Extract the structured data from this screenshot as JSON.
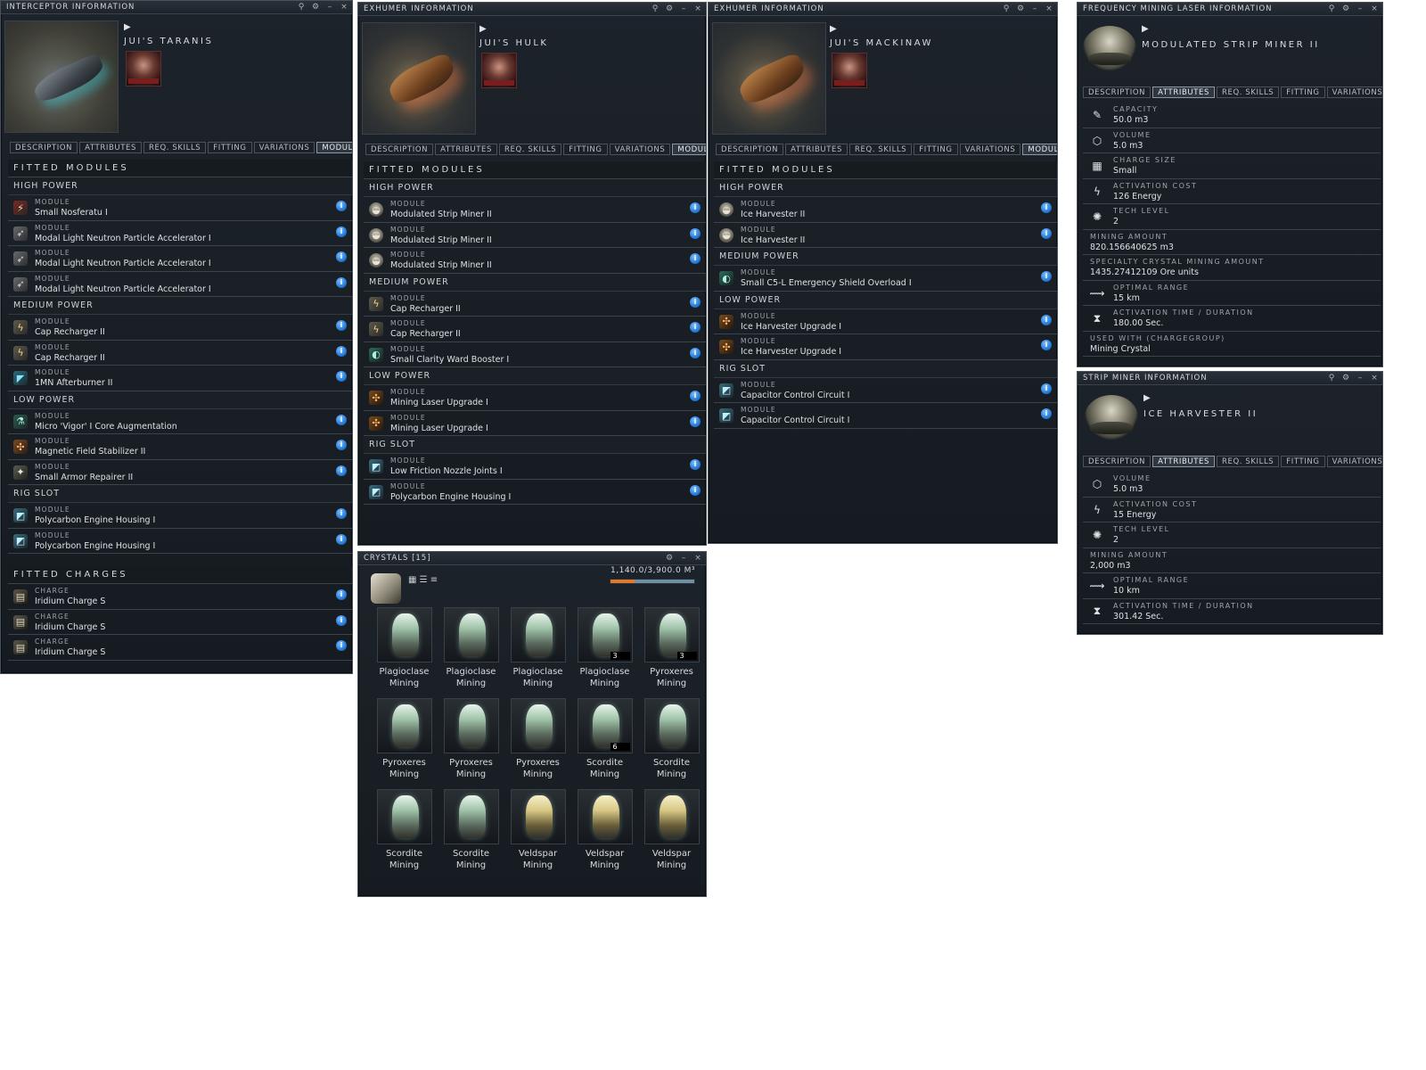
{
  "w1": {
    "title": "INTERCEPTOR INFORMATION",
    "ship": "JUI'S TARANIS",
    "tabs": [
      "DESCRIPTION",
      "ATTRIBUTES",
      "REQ. SKILLS",
      "FITTING",
      "VARIATIONS",
      "MODULES"
    ],
    "fitted_header": "FITTED MODULES",
    "groups": [
      {
        "name": "HIGH POWER",
        "items": [
          {
            "kind": "MODULE",
            "name": "Small Nosferatu I",
            "icon": "nosferatu-icon"
          },
          {
            "kind": "MODULE",
            "name": "Modal Light Neutron Particle Accelerator I",
            "icon": "blaster-icon"
          },
          {
            "kind": "MODULE",
            "name": "Modal Light Neutron Particle Accelerator I",
            "icon": "blaster-icon"
          },
          {
            "kind": "MODULE",
            "name": "Modal Light Neutron Particle Accelerator I",
            "icon": "blaster-icon"
          }
        ]
      },
      {
        "name": "MEDIUM POWER",
        "items": [
          {
            "kind": "MODULE",
            "name": "Cap Recharger II",
            "icon": "cap-recharger-icon"
          },
          {
            "kind": "MODULE",
            "name": "Cap Recharger II",
            "icon": "cap-recharger-icon"
          },
          {
            "kind": "MODULE",
            "name": "1MN Afterburner II",
            "icon": "afterburner-icon"
          }
        ]
      },
      {
        "name": "LOW POWER",
        "items": [
          {
            "kind": "MODULE",
            "name": "Micro 'Vigor' I Core Augmentation",
            "icon": "core-augmentation-icon"
          },
          {
            "kind": "MODULE",
            "name": "Magnetic Field Stabilizer II",
            "icon": "magnetic-stabilizer-icon"
          },
          {
            "kind": "MODULE",
            "name": "Small Armor Repairer II",
            "icon": "armor-repairer-icon"
          }
        ]
      },
      {
        "name": "RIG SLOT",
        "items": [
          {
            "kind": "MODULE",
            "name": "Polycarbon Engine Housing I",
            "icon": "rig-icon"
          },
          {
            "kind": "MODULE",
            "name": "Polycarbon Engine Housing I",
            "icon": "rig-icon"
          }
        ]
      }
    ],
    "charges_header": "FITTED CHARGES",
    "charges": [
      {
        "kind": "CHARGE",
        "name": "Iridium Charge S",
        "icon": "charge-icon"
      },
      {
        "kind": "CHARGE",
        "name": "Iridium Charge S",
        "icon": "charge-icon"
      },
      {
        "kind": "CHARGE",
        "name": "Iridium Charge S",
        "icon": "charge-icon"
      }
    ]
  },
  "w2": {
    "title": "EXHUMER INFORMATION",
    "ship": "JUI'S HULK",
    "tabs": [
      "DESCRIPTION",
      "ATTRIBUTES",
      "REQ. SKILLS",
      "FITTING",
      "VARIATIONS",
      "MODULES"
    ],
    "fitted_header": "FITTED MODULES",
    "groups": [
      {
        "name": "HIGH POWER",
        "items": [
          {
            "kind": "MODULE",
            "name": "Modulated Strip Miner II",
            "icon": "strip-miner-icon"
          },
          {
            "kind": "MODULE",
            "name": "Modulated Strip Miner II",
            "icon": "strip-miner-icon"
          },
          {
            "kind": "MODULE",
            "name": "Modulated Strip Miner II",
            "icon": "strip-miner-icon"
          }
        ]
      },
      {
        "name": "MEDIUM POWER",
        "items": [
          {
            "kind": "MODULE",
            "name": "Cap Recharger II",
            "icon": "cap-recharger-icon"
          },
          {
            "kind": "MODULE",
            "name": "Cap Recharger II",
            "icon": "cap-recharger-icon"
          },
          {
            "kind": "MODULE",
            "name": "Small Clarity Ward Booster I",
            "icon": "shield-booster-icon"
          }
        ]
      },
      {
        "name": "LOW POWER",
        "items": [
          {
            "kind": "MODULE",
            "name": "Mining Laser Upgrade I",
            "icon": "mining-upgrade-icon"
          },
          {
            "kind": "MODULE",
            "name": "Mining Laser Upgrade I",
            "icon": "mining-upgrade-icon"
          }
        ]
      },
      {
        "name": "RIG SLOT",
        "items": [
          {
            "kind": "MODULE",
            "name": "Low Friction Nozzle Joints I",
            "icon": "rig-icon"
          },
          {
            "kind": "MODULE",
            "name": "Polycarbon Engine Housing I",
            "icon": "rig-icon"
          }
        ]
      }
    ]
  },
  "w3": {
    "title": "EXHUMER INFORMATION",
    "ship": "JUI'S MACKINAW",
    "tabs": [
      "DESCRIPTION",
      "ATTRIBUTES",
      "REQ. SKILLS",
      "FITTING",
      "VARIATIONS",
      "MODULES"
    ],
    "fitted_header": "FITTED MODULES",
    "groups": [
      {
        "name": "HIGH POWER",
        "items": [
          {
            "kind": "MODULE",
            "name": "Ice Harvester II",
            "icon": "ice-harvester-icon"
          },
          {
            "kind": "MODULE",
            "name": "Ice Harvester II",
            "icon": "ice-harvester-icon"
          }
        ]
      },
      {
        "name": "MEDIUM POWER",
        "items": [
          {
            "kind": "MODULE",
            "name": "Small C5-L Emergency Shield Overload I",
            "icon": "shield-booster-icon"
          }
        ]
      },
      {
        "name": "LOW POWER",
        "items": [
          {
            "kind": "MODULE",
            "name": "Ice Harvester Upgrade I",
            "icon": "mining-upgrade-icon"
          },
          {
            "kind": "MODULE",
            "name": "Ice Harvester Upgrade I",
            "icon": "mining-upgrade-icon"
          }
        ]
      },
      {
        "name": "RIG SLOT",
        "items": [
          {
            "kind": "MODULE",
            "name": "Capacitor Control Circuit I",
            "icon": "rig-icon"
          },
          {
            "kind": "MODULE",
            "name": "Capacitor Control Circuit I",
            "icon": "rig-icon"
          }
        ]
      }
    ]
  },
  "w4": {
    "title": "FREQUENCY MINING LASER INFORMATION",
    "item": "MODULATED STRIP MINER II",
    "tabs": [
      "DESCRIPTION",
      "ATTRIBUTES",
      "REQ. SKILLS",
      "FITTING",
      "VARIATIONS"
    ],
    "attrs": [
      {
        "label": "CAPACITY",
        "value": "50.0 m3",
        "icon": "capacity-icon"
      },
      {
        "label": "VOLUME",
        "value": "5.0 m3",
        "icon": "volume-icon"
      },
      {
        "label": "CHARGE SIZE",
        "value": "Small",
        "icon": "charge-size-icon"
      },
      {
        "label": "ACTIVATION COST",
        "value": "126 Energy",
        "icon": "energy-icon"
      },
      {
        "label": "TECH LEVEL",
        "value": "2",
        "icon": "tech-level-icon"
      },
      {
        "label": "MINING AMOUNT",
        "value": "820.156640625 m3",
        "icon": ""
      },
      {
        "label": "SPECIALTY CRYSTAL MINING AMOUNT",
        "value": "1435.27412109 Ore units",
        "icon": ""
      },
      {
        "label": "OPTIMAL RANGE",
        "value": "15 km",
        "icon": "range-icon"
      },
      {
        "label": "ACTIVATION TIME / DURATION",
        "value": "180.00 Sec.",
        "icon": "hourglass-icon"
      },
      {
        "label": "USED WITH (CHARGEGROUP)",
        "value": "Mining Crystal",
        "icon": ""
      }
    ]
  },
  "w5": {
    "title": "STRIP MINER INFORMATION",
    "item": "ICE HARVESTER II",
    "tabs": [
      "DESCRIPTION",
      "ATTRIBUTES",
      "REQ. SKILLS",
      "FITTING",
      "VARIATIONS"
    ],
    "attrs": [
      {
        "label": "VOLUME",
        "value": "5.0 m3",
        "icon": "volume-icon"
      },
      {
        "label": "ACTIVATION COST",
        "value": "15 Energy",
        "icon": "energy-icon"
      },
      {
        "label": "TECH LEVEL",
        "value": "2",
        "icon": "tech-level-icon"
      },
      {
        "label": "MINING AMOUNT",
        "value": "2,000 m3",
        "icon": ""
      },
      {
        "label": "OPTIMAL RANGE",
        "value": "10 km",
        "icon": "range-icon"
      },
      {
        "label": "ACTIVATION TIME / DURATION",
        "value": "301.42 Sec.",
        "icon": "hourglass-icon"
      }
    ]
  },
  "crystals": {
    "title": "CRYSTALS [15]",
    "capacity": "1,140.0/3,900.0 M³",
    "fill_fraction": 0.29,
    "items": [
      {
        "name": "Plagioclase",
        "sub": "Mining",
        "qty": "",
        "tint": "green"
      },
      {
        "name": "Plagioclase",
        "sub": "Mining",
        "qty": "",
        "tint": "green"
      },
      {
        "name": "Plagioclase",
        "sub": "Mining",
        "qty": "",
        "tint": "green"
      },
      {
        "name": "Plagioclase",
        "sub": "Mining",
        "qty": "3",
        "tint": "green"
      },
      {
        "name": "Pyroxeres",
        "sub": "Mining",
        "qty": "3",
        "tint": "green"
      },
      {
        "name": "Pyroxeres",
        "sub": "Mining",
        "qty": "",
        "tint": "green"
      },
      {
        "name": "Pyroxeres",
        "sub": "Mining",
        "qty": "",
        "tint": "green"
      },
      {
        "name": "Pyroxeres",
        "sub": "Mining",
        "qty": "",
        "tint": "green"
      },
      {
        "name": "Scordite",
        "sub": "Mining",
        "qty": "6",
        "tint": "green"
      },
      {
        "name": "Scordite",
        "sub": "Mining",
        "qty": "",
        "tint": "green"
      },
      {
        "name": "Scordite",
        "sub": "Mining",
        "qty": "",
        "tint": "green"
      },
      {
        "name": "Scordite",
        "sub": "Mining",
        "qty": "",
        "tint": "green"
      },
      {
        "name": "Veldspar",
        "sub": "Mining",
        "qty": "",
        "tint": "gold"
      },
      {
        "name": "Veldspar",
        "sub": "Mining",
        "qty": "",
        "tint": "gold"
      },
      {
        "name": "Veldspar",
        "sub": "Mining",
        "qty": "",
        "tint": "gold"
      }
    ]
  },
  "colors": {
    "bg": "#161b21",
    "border": "#4a525b",
    "info": "#1a6fd0",
    "capbar": "#e07a2a"
  }
}
